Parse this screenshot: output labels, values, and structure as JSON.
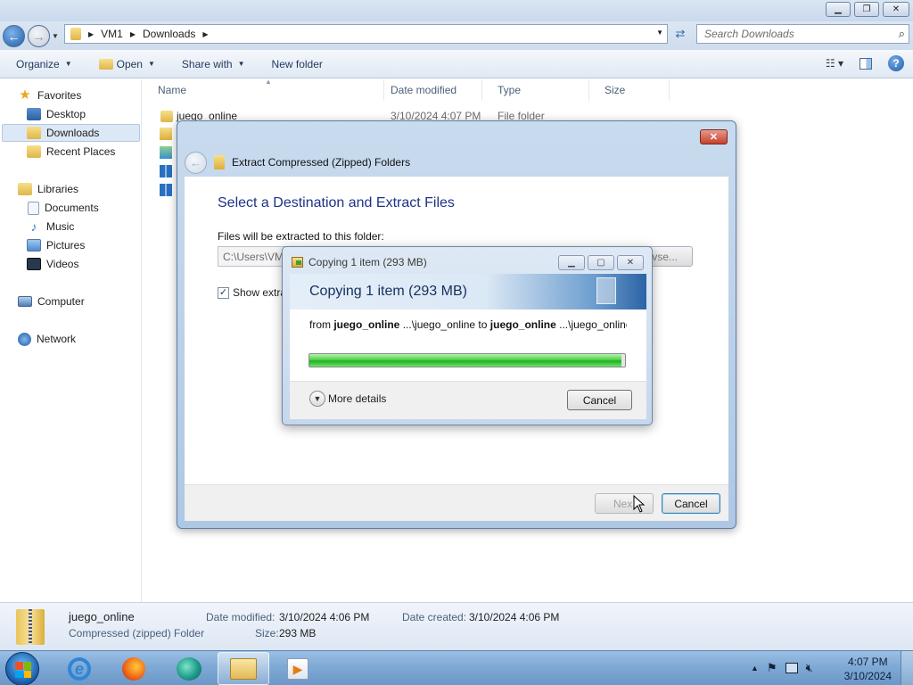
{
  "explorer": {
    "address": {
      "segments": [
        "VM1",
        "Downloads"
      ]
    },
    "search": {
      "placeholder": "Search Downloads"
    },
    "toolbar": {
      "organize": "Organize",
      "open": "Open",
      "share_with": "Share with",
      "new_folder": "New folder"
    },
    "nav": {
      "favorites": "Favorites",
      "desktop": "Desktop",
      "downloads": "Downloads",
      "recent_places": "Recent Places",
      "libraries": "Libraries",
      "documents": "Documents",
      "music": "Music",
      "pictures": "Pictures",
      "videos": "Videos",
      "computer": "Computer",
      "network": "Network"
    },
    "columns": {
      "name": "Name",
      "date_modified": "Date modified",
      "type": "Type",
      "size": "Size"
    },
    "files": [
      {
        "name": "juego_online",
        "date_modified": "3/10/2024 4:07 PM",
        "type": "File folder"
      }
    ],
    "details": {
      "name": "juego_online",
      "type": "Compressed (zipped) Folder",
      "date_modified_label": "Date modified:",
      "date_modified": "3/10/2024 4:06 PM",
      "date_created_label": "Date created:",
      "date_created": "3/10/2024 4:06 PM",
      "size_label": "Size:",
      "size": "293 MB"
    }
  },
  "extract_dialog": {
    "title": "Extract Compressed (Zipped) Folders",
    "heading": "Select a Destination and Extract Files",
    "files_label": "Files will be extracted to this folder:",
    "path_value": "C:\\Users\\VM",
    "browse_label": "vse...",
    "show_label": "Show extra",
    "show_checked": true,
    "next_label": "Nex",
    "cancel_label": "Cancel"
  },
  "copy_dialog": {
    "title": "Copying 1 item (293 MB)",
    "banner": "Copying 1 item (293 MB)",
    "from_prefix": "from ",
    "from_name": "juego_online",
    "from_path": " ...\\juego_online",
    "to_word": " to ",
    "to_name": "juego_online",
    "to_path": " ...\\juego_online",
    "progress": 0.99,
    "more_details": "More details",
    "cancel_label": "Cancel"
  },
  "taskbar": {
    "time": "4:07 PM",
    "date": "3/10/2024"
  },
  "icons": {
    "ie": "e",
    "media_player": "▶"
  }
}
